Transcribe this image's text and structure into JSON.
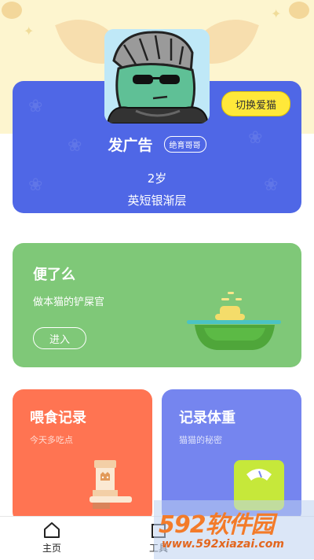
{
  "pet": {
    "name": "发广告",
    "badge": "绝育哥哥",
    "age": "2岁",
    "breed": "英短银渐层",
    "switch_label": "切换爱猫"
  },
  "toilet_card": {
    "title": "便了么",
    "subtitle": "做本猫的铲屎官",
    "enter_label": "进入"
  },
  "feed_card": {
    "title": "喂食记录",
    "subtitle": "今天多吃点"
  },
  "weight_card": {
    "title": "记录体重",
    "subtitle": "猫猫的秘密"
  },
  "tabbar": {
    "items": [
      {
        "label": "主页",
        "icon": "home-icon"
      },
      {
        "label": "工具",
        "icon": "tools-icon"
      }
    ]
  },
  "watermark": {
    "brand": "592软件园",
    "url": "www.592xiazai.com"
  },
  "colors": {
    "pet_card": "#4f67e6",
    "toilet_card": "#7fc878",
    "feed_card": "#ff7452",
    "weight_card": "#7585ef",
    "switch_button": "#ffe83a",
    "watermark_text": "#f37b2a"
  }
}
